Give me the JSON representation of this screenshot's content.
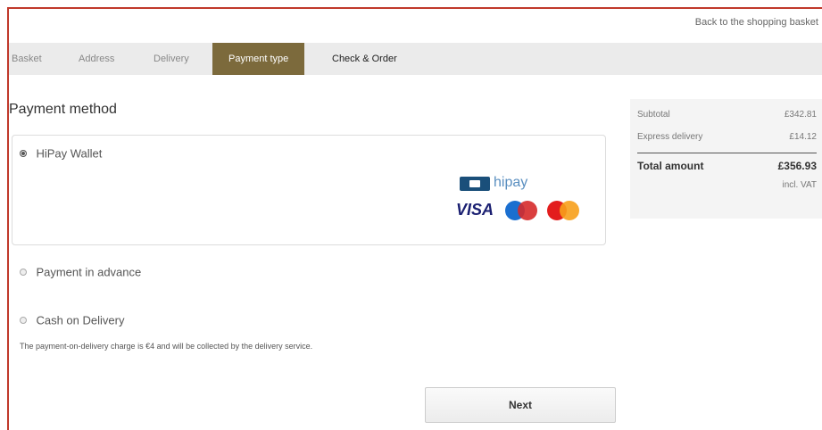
{
  "header": {
    "back_link": "Back to the shopping basket"
  },
  "steps": [
    {
      "label": "Basket",
      "state": "done"
    },
    {
      "label": "Address",
      "state": "done"
    },
    {
      "label": "Delivery",
      "state": "done"
    },
    {
      "label": "Payment type",
      "state": "active"
    },
    {
      "label": "Check & Order",
      "state": "upcoming"
    }
  ],
  "payment": {
    "title": "Payment method",
    "options": [
      {
        "label": "HiPay Wallet",
        "selected": true
      },
      {
        "label": "Payment in advance",
        "selected": false
      },
      {
        "label": "Cash on Delivery",
        "selected": false
      }
    ],
    "cod_note": "The payment-on-delivery charge is €4 and will be collected by the delivery service.",
    "logos": {
      "hipay": "hipay",
      "visa": "VISA",
      "maestro_icon": "maestro-logo",
      "mastercard_icon": "mastercard-logo"
    }
  },
  "summary": {
    "subtotal_label": "Subtotal",
    "subtotal_value": "£342.81",
    "delivery_label": "Express delivery",
    "delivery_value": "£14.12",
    "total_label": "Total amount",
    "total_value": "£356.93",
    "vat_note": "incl. VAT"
  },
  "actions": {
    "next": "Next"
  },
  "colors": {
    "accent": "#7c6a3c",
    "frame": "#c0392b"
  }
}
